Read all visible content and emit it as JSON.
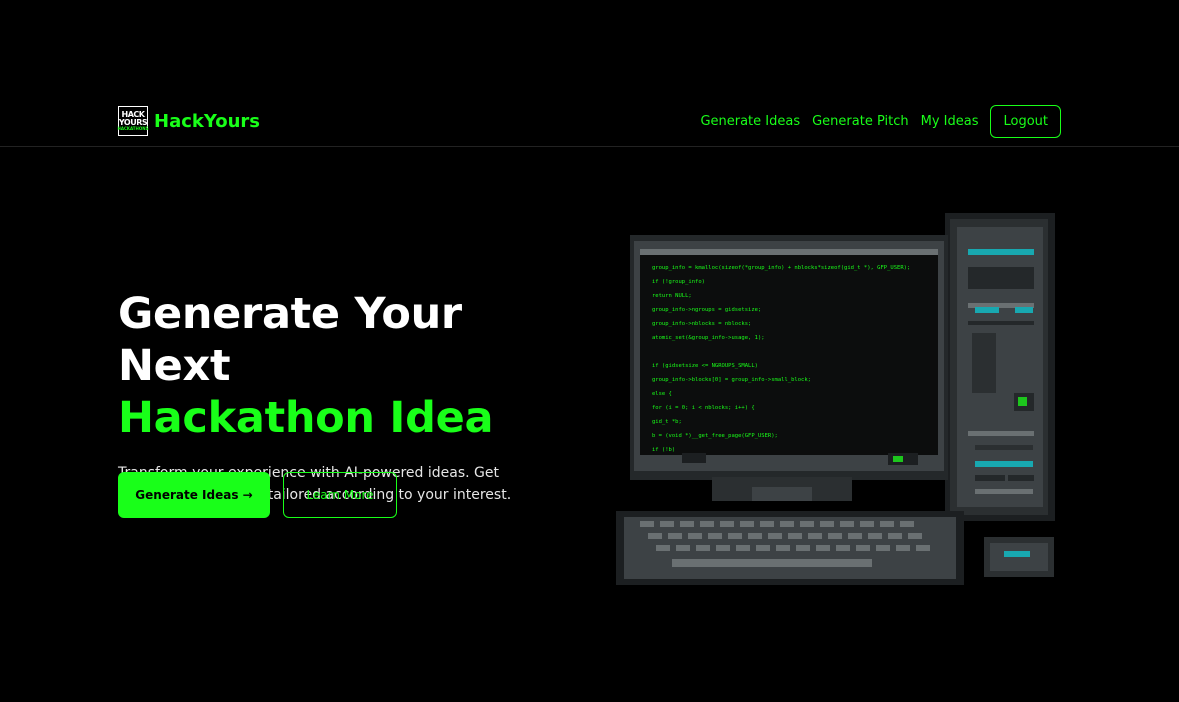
{
  "nav": {
    "logo_text_line1": "HACK",
    "logo_text_line2": "YOURS",
    "logo_text_line3": "HACKATHONS",
    "brand": "HackYours",
    "links": [
      "Generate Ideas",
      "Generate Pitch",
      "My Ideas"
    ],
    "logout": "Logout"
  },
  "hero": {
    "title_line1": "Generate Your Next",
    "title_line2": "Hackathon Idea",
    "description": "Transform your experience with AI-powered ideas. Get detailed suggestions tailored according to your interest.",
    "primary_button": "Generate Ideas →",
    "secondary_button": "Learn More"
  },
  "illustration": {
    "code_lines": [
      "group_info = kmalloc(sizeof(*group_info) + nblocks*sizeof(gid_t *), GFP_USER);",
      "if (!group_info)",
      "    return NULL;",
      "group_info->ngroups = gidsetsize;",
      "group_info->nblocks = nblocks;",
      "atomic_set(&group_info->usage, 1);",
      "",
      "if (gidsetsize <= NGROUPS_SMALL)",
      "    group_info->blocks[0] = group_info->small_block;",
      "else {",
      "    for (i = 0; i < nblocks; i++) {",
      "        gid_t *b;",
      "        b = (void *)__get_free_page(GFP_USER);",
      "        if (!b)"
    ]
  },
  "colors": {
    "accent": "#19ff19",
    "background": "#000000",
    "text": "#ffffff"
  }
}
